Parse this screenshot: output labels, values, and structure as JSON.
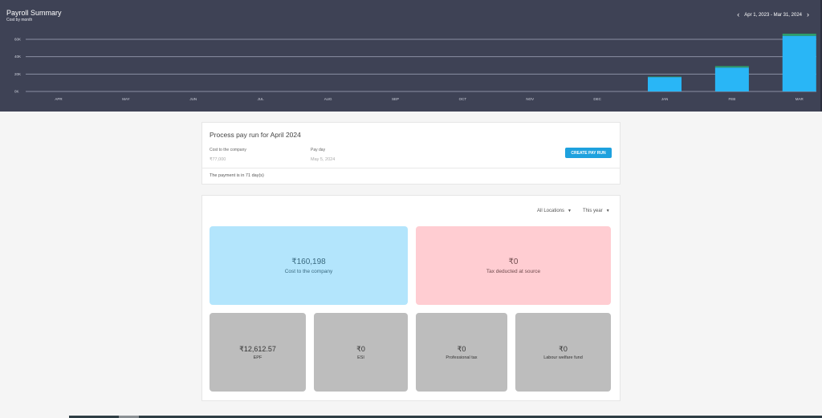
{
  "chart": {
    "title": "Payroll Summary",
    "subtitle": "Cost by month",
    "date_range": "Apr 1, 2023 - Mar 31, 2024",
    "prev_icon": "chevron-left-icon",
    "next_icon": "chevron-right-icon",
    "prev_glyph": "‹",
    "next_glyph": "›"
  },
  "chart_data": {
    "type": "bar",
    "categories": [
      "APR",
      "MAY",
      "JUN",
      "JUL",
      "AUG",
      "SEP",
      "OCT",
      "NOV",
      "DEC",
      "JAN",
      "FEB",
      "MAR"
    ],
    "series": [
      {
        "values": [
          0,
          0,
          0,
          0,
          0,
          0,
          0,
          0,
          0,
          16500,
          27500,
          64000
        ],
        "color": "#29b6f6"
      },
      {
        "values": [
          0,
          0,
          0,
          0,
          0,
          0,
          0,
          0,
          0,
          600,
          1700,
          2500
        ],
        "color": "#2e9e6a"
      }
    ],
    "y_ticks": [
      "0K",
      "20K",
      "40K",
      "60K"
    ],
    "ylim": [
      0,
      60000
    ],
    "stacked": true,
    "grid": true
  },
  "payrun": {
    "title": "Process pay run for April 2024",
    "cost_label": "Cost to the company",
    "cost_value": "₹77,000",
    "payday_label": "Pay day",
    "payday_value": "May 5, 2024",
    "button_label": "CREATE PAY RUN",
    "footer": "The payment is in 71 day(s)"
  },
  "filters": {
    "location": "All Locations",
    "period": "This year",
    "caret": "▼"
  },
  "tiles": {
    "ctc": {
      "value": "₹160,198",
      "label": "Cost to the company",
      "bg": "#b3e5fc",
      "color": "#3a6a80"
    },
    "tds": {
      "value": "₹0",
      "label": "Tax deducted at source",
      "bg": "#ffcdd2",
      "color": "#6e4a4c"
    },
    "epf": {
      "value": "₹12,612.57",
      "label": "EPF"
    },
    "esi": {
      "value": "₹0",
      "label": "ESI"
    },
    "pt": {
      "value": "₹0",
      "label": "Professional tax"
    },
    "lwf": {
      "value": "₹0",
      "label": "Labour welfare fund"
    },
    "small_bg": "#bdbdbd",
    "small_color": "#333333"
  }
}
